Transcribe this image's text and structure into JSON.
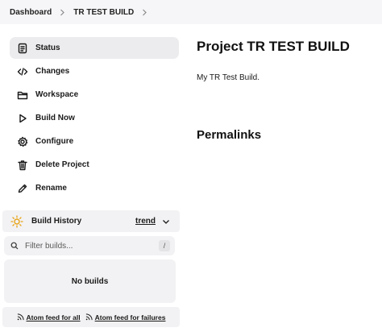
{
  "breadcrumbs": [
    {
      "label": "Dashboard"
    },
    {
      "label": "TR TEST BUILD"
    }
  ],
  "tasks": [
    {
      "label": "Status",
      "icon": "document-icon",
      "active": true
    },
    {
      "label": "Changes",
      "icon": "code-icon"
    },
    {
      "label": "Workspace",
      "icon": "folder-icon"
    },
    {
      "label": "Build Now",
      "icon": "play-icon"
    },
    {
      "label": "Configure",
      "icon": "gear-icon"
    },
    {
      "label": "Delete Project",
      "icon": "trash-icon"
    },
    {
      "label": "Rename",
      "icon": "pencil-icon"
    }
  ],
  "build_history": {
    "title": "Build History",
    "trend_label": "trend",
    "filter_placeholder": "Filter builds...",
    "filter_shortcut": "/",
    "empty_text": "No builds",
    "feeds": {
      "all_label": "Atom feed for all",
      "failures_label": "Atom feed for failures"
    }
  },
  "main": {
    "title": "Project TR TEST BUILD",
    "description": "My TR Test Build.",
    "permalinks_heading": "Permalinks"
  },
  "colors": {
    "sun_icon": "#e8a317",
    "panel_bg": "#f2f2f4",
    "active_task_bg": "#ececee"
  }
}
